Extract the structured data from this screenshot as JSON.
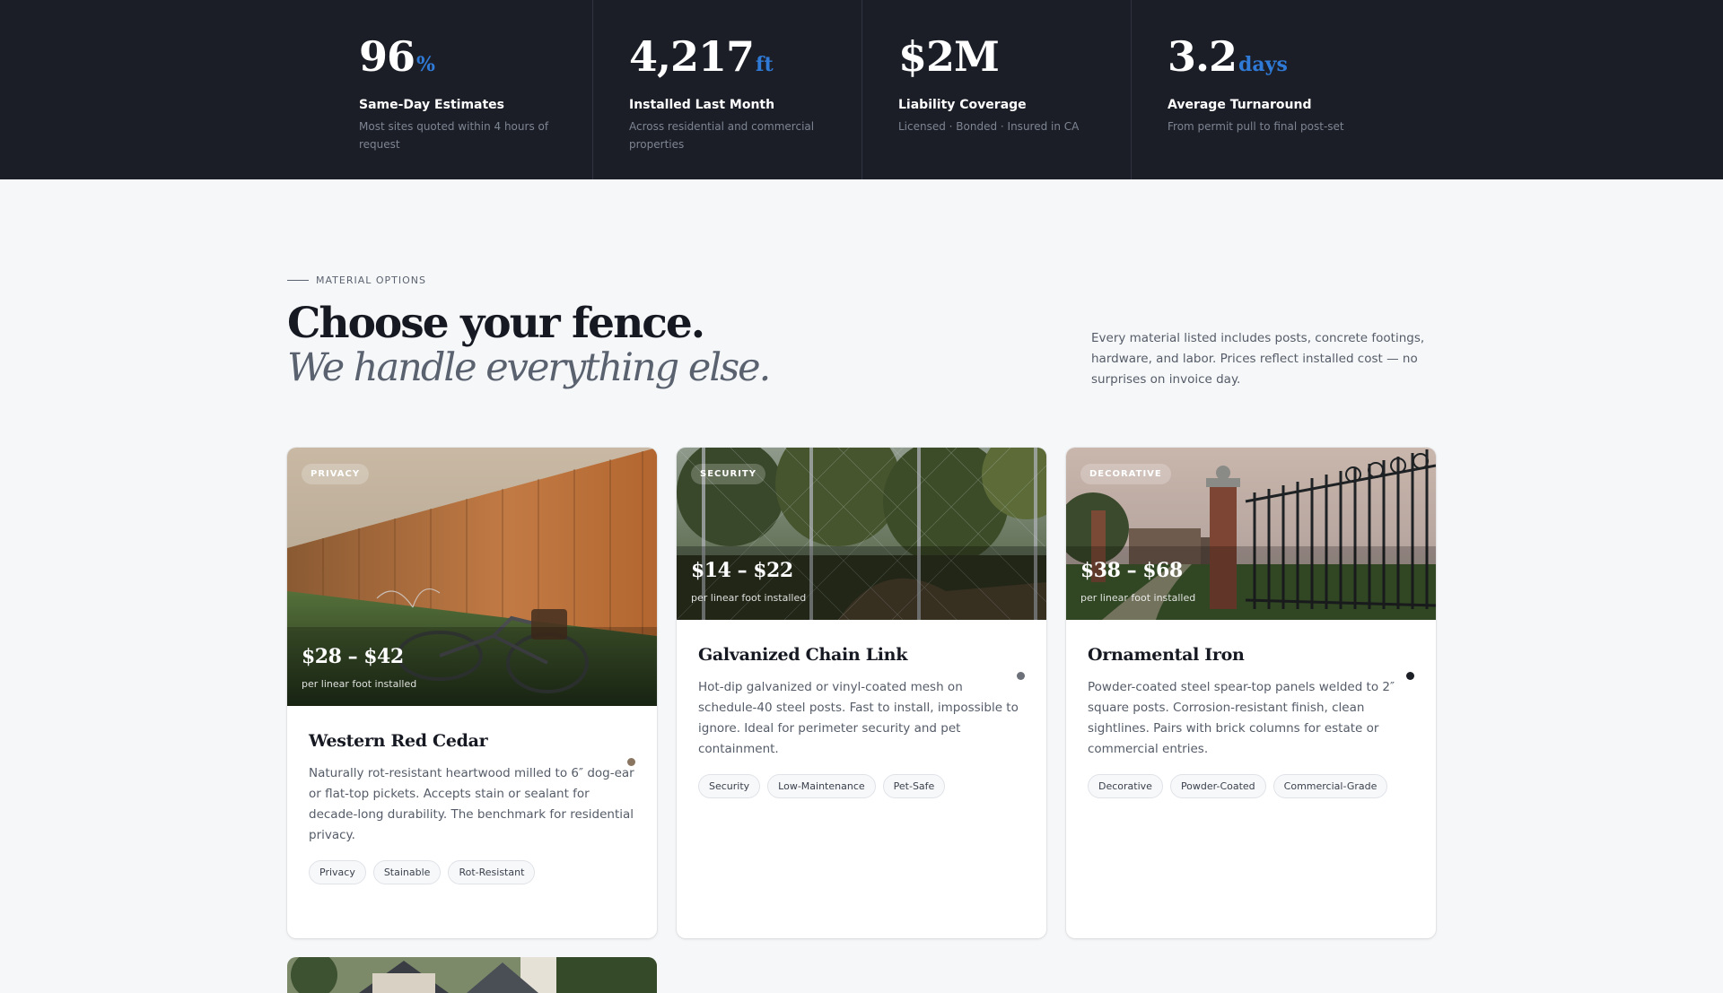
{
  "stats": [
    {
      "value": "96",
      "unit": "%",
      "label": "Same-Day Estimates",
      "desc": "Most sites quoted within 4 hours of request"
    },
    {
      "value": "4,217",
      "unit": "ft",
      "label": "Installed Last Month",
      "desc": "Across residential and commercial properties"
    },
    {
      "value": "$2M",
      "unit": "",
      "label": "Liability Coverage",
      "desc": "Licensed · Bonded · Insured in CA"
    },
    {
      "value": "3.2",
      "unit": "days",
      "label": "Average Turnaround",
      "desc": "From permit pull to final post-set"
    }
  ],
  "section": {
    "eyebrow": "MATERIAL OPTIONS",
    "headline": "Choose your fence.",
    "subheadline": "We handle everything else.",
    "intro": "Every material listed includes posts, concrete footings, hardware, and labor. Prices reflect installed cost — no surprises on invoice day."
  },
  "cards": [
    {
      "chip": "PRIVACY",
      "price": "$28 – $42",
      "price_sub": "per linear foot installed",
      "title": "Western Red Cedar",
      "dot_color": "#8a7560",
      "desc": "Naturally rot-resistant heartwood milled to 6″ dog-ear or flat-top pickets. Accepts stain or sealant for decade-long durability. The benchmark for residential privacy.",
      "tags": [
        "Privacy",
        "Stainable",
        "Rot-Resistant"
      ]
    },
    {
      "chip": "SECURITY",
      "price": "$14 – $22",
      "price_sub": "per linear foot installed",
      "title": "Galvanized Chain Link",
      "dot_color": "#6b7079",
      "desc": "Hot-dip galvanized or vinyl-coated mesh on schedule-40 steel posts. Fast to install, impossible to ignore. Ideal for perimeter security and pet containment.",
      "tags": [
        "Security",
        "Low-Maintenance",
        "Pet-Safe"
      ]
    },
    {
      "chip": "DECORATIVE",
      "price": "$38 – $68",
      "price_sub": "per linear foot installed",
      "title": "Ornamental Iron",
      "dot_color": "#1c1f26",
      "desc": "Powder-coated steel spear-top panels welded to 2″ square posts. Corrosion-resistant finish, clean sightlines. Pairs with brick columns for estate or commercial entries.",
      "tags": [
        "Decorative",
        "Powder-Coated",
        "Commercial-Grade"
      ]
    }
  ]
}
